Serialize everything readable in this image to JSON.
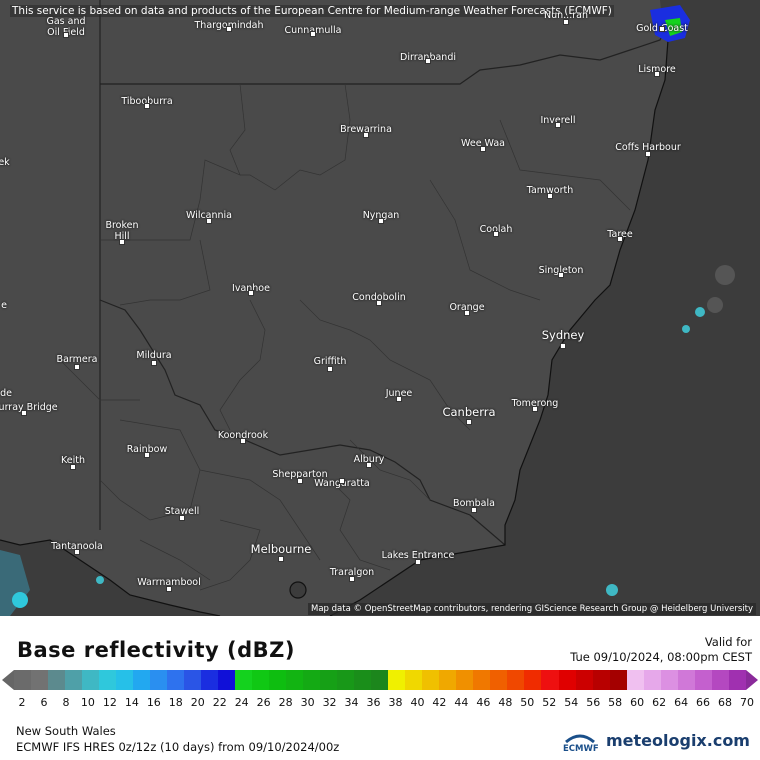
{
  "banner": "This service is based on data and products of the European Centre for Medium-range Weather Forecasts (ECMWF)",
  "attribution": "Map data © OpenStreetMap contributors, rendering GIScience Research Group @ Heidelberg University",
  "places": [
    {
      "id": "gold-coast",
      "label": "Gold Coast"
    },
    {
      "id": "gas-oil",
      "label": "Gas and\nOil Field"
    },
    {
      "id": "thargomindah",
      "label": "Thargomindah"
    },
    {
      "id": "cunnamulla",
      "label": "Cunnamulla"
    },
    {
      "id": "dirranbandi",
      "label": "Dirranbandi"
    },
    {
      "id": "lismore",
      "label": "Lismore"
    },
    {
      "id": "tibooburra",
      "label": "Tibooburra"
    },
    {
      "id": "brewarrina",
      "label": "Brewarrina"
    },
    {
      "id": "inverell",
      "label": "Inverell"
    },
    {
      "id": "wee-waa",
      "label": "Wee Waa"
    },
    {
      "id": "coffs-harbour",
      "label": "Coffs Harbour"
    },
    {
      "id": "tamworth",
      "label": "Tamworth"
    },
    {
      "id": "wilcannia",
      "label": "Wilcannia"
    },
    {
      "id": "nyngan",
      "label": "Nyngan"
    },
    {
      "id": "broken-hill",
      "label": "Broken\nHill"
    },
    {
      "id": "coolah",
      "label": "Coolah"
    },
    {
      "id": "taree",
      "label": "Taree"
    },
    {
      "id": "singleton",
      "label": "Singleton"
    },
    {
      "id": "ivanhoe",
      "label": "Ivanhoe"
    },
    {
      "id": "condobolin",
      "label": "Condobolin"
    },
    {
      "id": "orange",
      "label": "Orange"
    },
    {
      "id": "sydney",
      "label": "Sydney"
    },
    {
      "id": "barmera",
      "label": "Barmera"
    },
    {
      "id": "mildura",
      "label": "Mildura"
    },
    {
      "id": "griffith",
      "label": "Griffith"
    },
    {
      "id": "junee",
      "label": "Junee"
    },
    {
      "id": "murray-bridge",
      "label": "Murray Bridge"
    },
    {
      "id": "canberra",
      "label": "Canberra"
    },
    {
      "id": "tomerong",
      "label": "Tomerong"
    },
    {
      "id": "koondrook",
      "label": "Koondrook"
    },
    {
      "id": "rainbow",
      "label": "Rainbow"
    },
    {
      "id": "keith",
      "label": "Keith"
    },
    {
      "id": "albury",
      "label": "Albury"
    },
    {
      "id": "shepparton",
      "label": "Shepparton"
    },
    {
      "id": "wangaratta",
      "label": "Wangaratta"
    },
    {
      "id": "bombala",
      "label": "Bombala"
    },
    {
      "id": "stawell",
      "label": "Stawell"
    },
    {
      "id": "tantanoola",
      "label": "Tantanoola"
    },
    {
      "id": "melbourne",
      "label": "Melbourne"
    },
    {
      "id": "lakes-entrance",
      "label": "Lakes Entrance"
    },
    {
      "id": "traralgon",
      "label": "Traralgon"
    },
    {
      "id": "warrnambool",
      "label": "Warrnambool"
    },
    {
      "id": "edge-ek",
      "label": "ek"
    },
    {
      "id": "edge-de",
      "label": "de"
    },
    {
      "id": "edge-e",
      "label": "e"
    },
    {
      "id": "edge-top",
      "label": "Nun...ran"
    }
  ],
  "legend": {
    "title": "Base reflectivity (dBZ)",
    "valid_label": "Valid for",
    "valid_time": "Tue 09/10/2024, 08:00pm CEST",
    "ticks": [
      "2",
      "6",
      "8",
      "10",
      "12",
      "14",
      "16",
      "18",
      "20",
      "22",
      "24",
      "26",
      "28",
      "30",
      "32",
      "34",
      "36",
      "38",
      "40",
      "42",
      "44",
      "46",
      "48",
      "50",
      "52",
      "54",
      "56",
      "58",
      "60",
      "62",
      "64",
      "66",
      "68",
      "70"
    ],
    "colors": [
      "#6b6b6b",
      "#727272",
      "#5c8a8e",
      "#4fa0a8",
      "#3fb8c4",
      "#2fc8dc",
      "#26c0e8",
      "#22a8f0",
      "#2a8ff0",
      "#2e72ee",
      "#2a55e6",
      "#1a2ee0",
      "#1010d8",
      "#14d21e",
      "#10c814",
      "#0ebe10",
      "#12b412",
      "#14aa14",
      "#16a016",
      "#189818",
      "#1a8e1a",
      "#1c861c",
      "#f0f000",
      "#f0d800",
      "#f0c000",
      "#f0a800",
      "#f09000",
      "#f07800",
      "#f06000",
      "#f04800",
      "#f02c00",
      "#ee1010",
      "#e00000",
      "#cc0000",
      "#b80000",
      "#a40000",
      "#f0c0f0",
      "#e6a8ea",
      "#dc90e2",
      "#d078d8",
      "#c460ce",
      "#b448c0",
      "#a030b0"
    ],
    "region": "New South Wales",
    "model": "ECMWF IFS HRES 0z/12z (10 days) from 09/10/2024/00z",
    "ecmwf_logo": "ECMWF",
    "brand": "meteologix.com"
  }
}
